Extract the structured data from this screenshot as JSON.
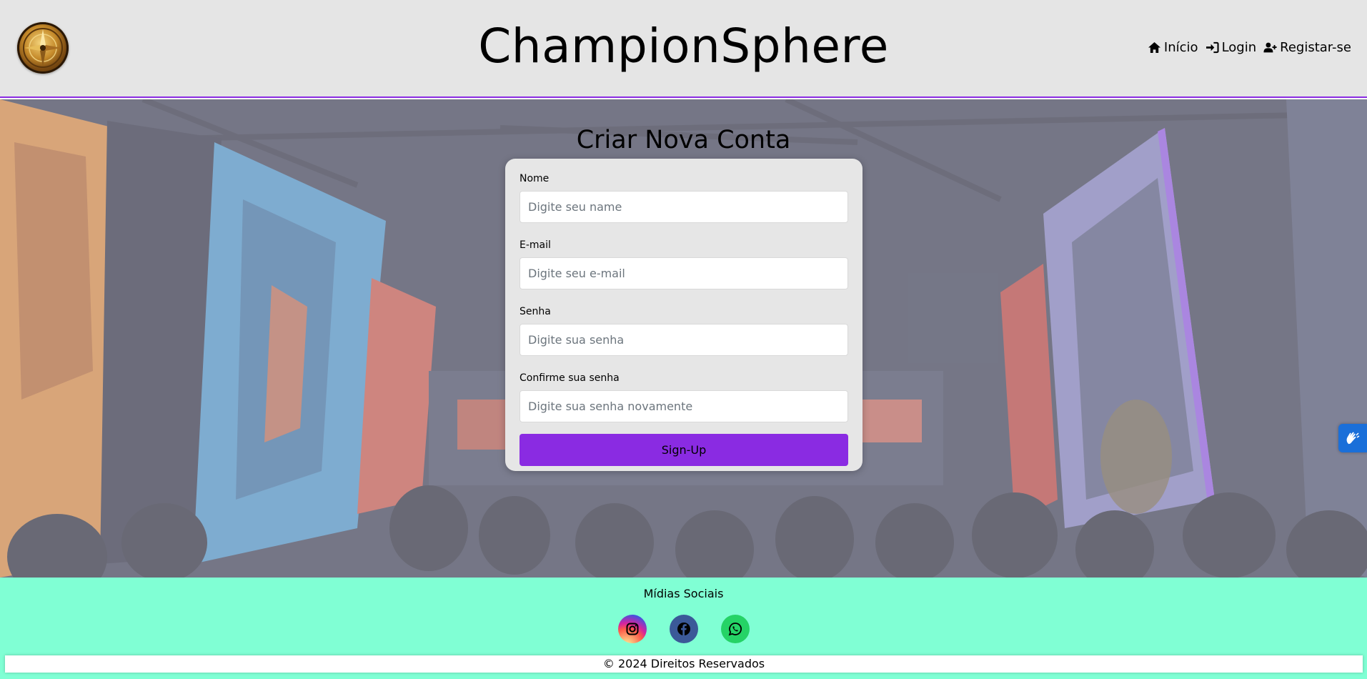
{
  "header": {
    "title": "ChampionSphere",
    "logo_icon": "compass-emblem-icon",
    "nav": [
      {
        "label": "Início",
        "icon": "home-icon"
      },
      {
        "label": "Login",
        "icon": "sign-in-icon"
      },
      {
        "label": "Registar-se",
        "icon": "user-plus-icon"
      }
    ]
  },
  "form": {
    "title": "Criar Nova Conta",
    "fields": [
      {
        "label": "Nome",
        "placeholder": "Digite seu name",
        "value": ""
      },
      {
        "label": "E-mail",
        "placeholder": "Digite seu e-mail",
        "value": ""
      },
      {
        "label": "Senha",
        "placeholder": "Digite sua senha",
        "value": ""
      },
      {
        "label": "Confirme sua senha",
        "placeholder": "Digite sua senha novamente",
        "value": ""
      }
    ],
    "submit_label": "Sign-Up"
  },
  "accessibility_widget": {
    "icon": "sign-language-hands-icon"
  },
  "footer": {
    "title": "Mídias Sociais",
    "socials": [
      {
        "name": "instagram",
        "icon": "instagram-icon"
      },
      {
        "name": "facebook",
        "icon": "facebook-icon"
      },
      {
        "name": "whatsapp",
        "icon": "whatsapp-icon"
      }
    ],
    "copyright": "© 2024 Direitos Reservados"
  },
  "colors": {
    "header_bg": "#e5e5e5",
    "accent": "#8a2be2",
    "footer_bg": "#80ffd4",
    "card_bg": "#e6e6e6",
    "widget_blue": "#1a6fd9"
  }
}
